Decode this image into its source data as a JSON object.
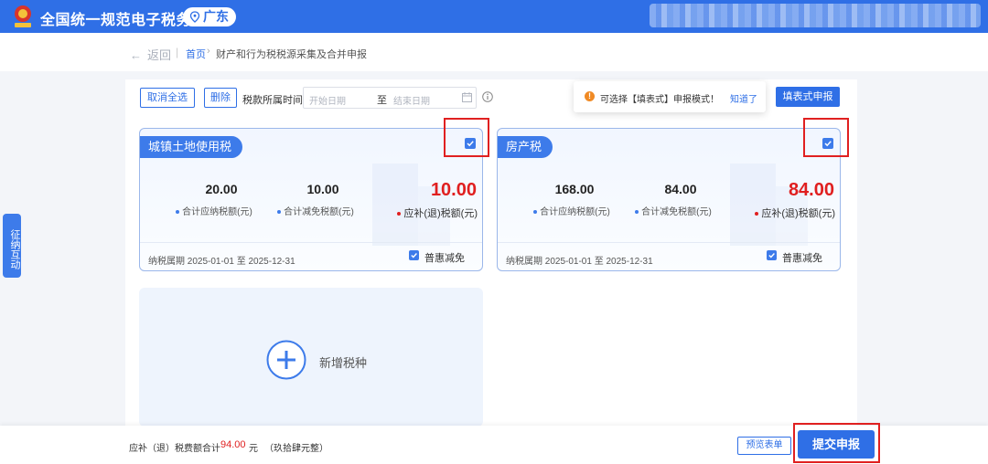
{
  "header": {
    "site_title": "全国统一规范电子税务局",
    "region": "广东",
    "emblem_icon": "tax-emblem-icon",
    "colors": {
      "primary": "#2f6fe6",
      "danger": "#e01f1f"
    }
  },
  "breadcrumb": {
    "back": "返回",
    "home": "首页",
    "separator": "›",
    "current": "财产和行为税税源采集及合并申报"
  },
  "side_tab": {
    "label": "征纳互动"
  },
  "toolbar": {
    "deselect_all": "取消全选",
    "delete": "删除",
    "period_label": "税款所属时间",
    "start_placeholder": "开始日期",
    "to": "至",
    "end_placeholder": "结束日期"
  },
  "tip": {
    "message": "可选择【填表式】申报模式！",
    "ok": "知道了"
  },
  "fill_form_button": "填表式申报",
  "cards": [
    {
      "name": "城镇土地使用税",
      "checked": true,
      "payable": "20.00",
      "payable_label": "合计应纳税额(元)",
      "reduced": "10.00",
      "reduced_label": "合计减免税额(元)",
      "due": "10.00",
      "due_label": "应补(退)税额(元)",
      "period": "纳税属期 2025-01-01 至 2025-12-31",
      "relief": "普惠减免",
      "relief_checked": true
    },
    {
      "name": "房产税",
      "checked": true,
      "payable": "168.00",
      "payable_label": "合计应纳税额(元)",
      "reduced": "84.00",
      "reduced_label": "合计减免税额(元)",
      "due": "84.00",
      "due_label": "应补(退)税额(元)",
      "period": "纳税属期 2025-01-01 至 2025-12-31",
      "relief": "普惠减免",
      "relief_checked": true
    }
  ],
  "add_tax": {
    "label": "新增税种"
  },
  "footer": {
    "total_label": "应补（退）税费额合计",
    "total_amount": "94.00",
    "unit": "元",
    "amount_in_words": "（玖拾肆元整）",
    "preview": "预览表单",
    "submit": "提交申报"
  }
}
